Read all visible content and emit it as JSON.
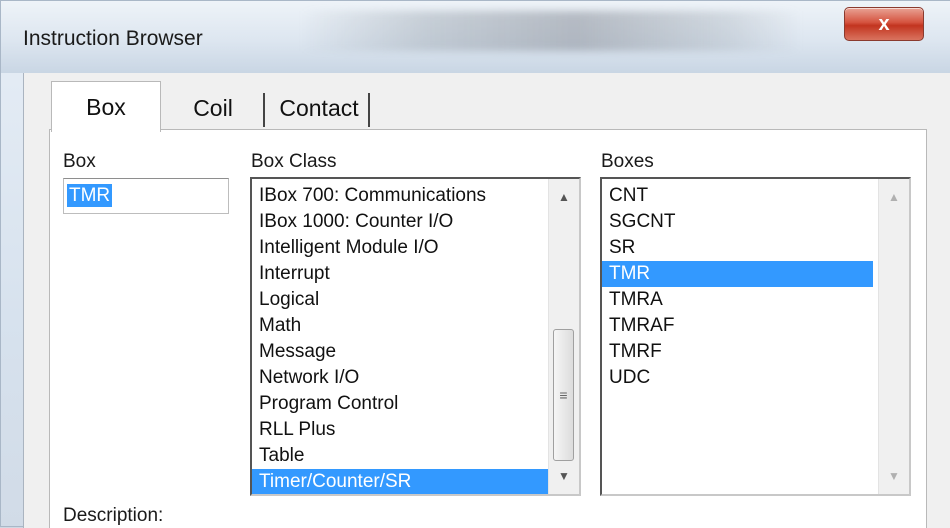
{
  "window": {
    "title": "Instruction Browser",
    "close_glyph": "x"
  },
  "tabs": [
    {
      "label": "Box",
      "active": true
    },
    {
      "label": "Coil",
      "active": false
    },
    {
      "label": "Contact",
      "active": false
    }
  ],
  "box_field": {
    "label": "Box",
    "value": "TMR"
  },
  "box_class": {
    "label": "Box Class",
    "items": [
      "IBox  700: Communications",
      "IBox 1000: Counter I/O",
      "Intelligent Module I/O",
      "Interrupt",
      "Logical",
      "Math",
      "Message",
      "Network I/O",
      "Program Control",
      "RLL Plus",
      "Table",
      "Timer/Counter/SR"
    ],
    "selected": "Timer/Counter/SR"
  },
  "boxes": {
    "label": "Boxes",
    "items": [
      "CNT",
      "SGCNT",
      "SR",
      "TMR",
      "TMRA",
      "TMRAF",
      "TMRF",
      "UDC"
    ],
    "selected": "TMR"
  },
  "description": {
    "label": "Description:"
  },
  "scroll_glyphs": {
    "up": "▲",
    "down": "▼",
    "grip": "≡"
  },
  "colors": {
    "selection": "#3399ff",
    "close_button": "#c9452f"
  }
}
